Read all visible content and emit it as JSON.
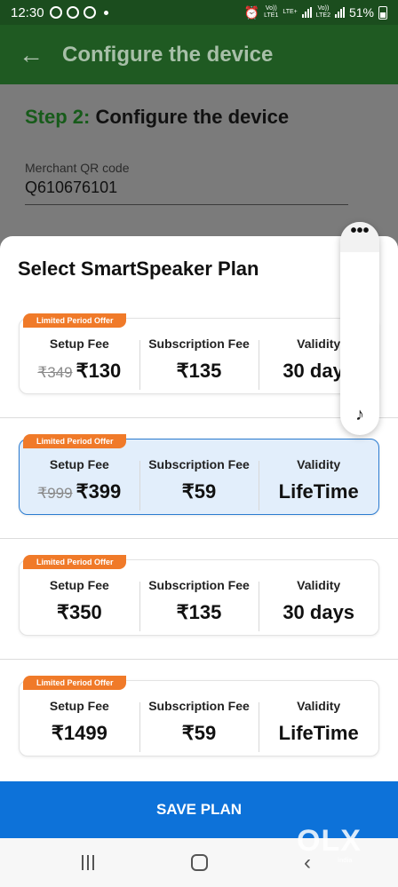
{
  "status_bar": {
    "time": "12:30",
    "sim1_top": "Vo))",
    "sim1_bottom": "LTE1",
    "sim1_network": "LTE+",
    "sim2_top": "Vo))",
    "sim2_bottom": "LTE2",
    "battery": "51%"
  },
  "app_bar": {
    "title": "Configure the device",
    "back_icon": "arrow-left-icon"
  },
  "page": {
    "step_number": "Step 2:",
    "step_title": " Configure the device",
    "qr_label": "Merchant QR code",
    "qr_value": "Q610676101"
  },
  "sheet": {
    "title": "Select SmartSpeaker Plan",
    "plans": [
      {
        "badge": "Limited Period Offer",
        "setup_label": "Setup Fee",
        "setup_old": "₹349",
        "setup": "₹130",
        "subscription_label": "Subscription Fee",
        "subscription": "₹135",
        "validity_label": "Validity",
        "validity": "30 days",
        "selected": false
      },
      {
        "badge": "Limited Period Offer",
        "setup_label": "Setup Fee",
        "setup_old": "₹999",
        "setup": "₹399",
        "subscription_label": "Subscription Fee",
        "subscription": "₹59",
        "validity_label": "Validity",
        "validity": "LifeTime",
        "selected": true
      },
      {
        "badge": "Limited Period Offer",
        "setup_label": "Setup Fee",
        "setup_old": "",
        "setup": "₹350",
        "subscription_label": "Subscription Fee",
        "subscription": "₹135",
        "validity_label": "Validity",
        "validity": "30 days",
        "selected": false
      },
      {
        "badge": "Limited Period Offer",
        "setup_label": "Setup Fee",
        "setup_old": "",
        "setup": "₹1499",
        "subscription_label": "Subscription Fee",
        "subscription": "₹59",
        "validity_label": "Validity",
        "validity": "LifeTime",
        "selected": false
      }
    ],
    "save_label": "SAVE PLAN"
  },
  "floating_widget": {
    "menu_icon": "more-horizontal-icon",
    "sound_icon": "music-note-icon"
  },
  "watermark": {
    "logo": "OLX",
    "sub": "india"
  },
  "colors": {
    "app_bar": "#1f5a22",
    "step_accent": "#175b1a",
    "badge": "#f07a29",
    "selected_bg": "#e2eefb",
    "save_button": "#0d72d9"
  }
}
